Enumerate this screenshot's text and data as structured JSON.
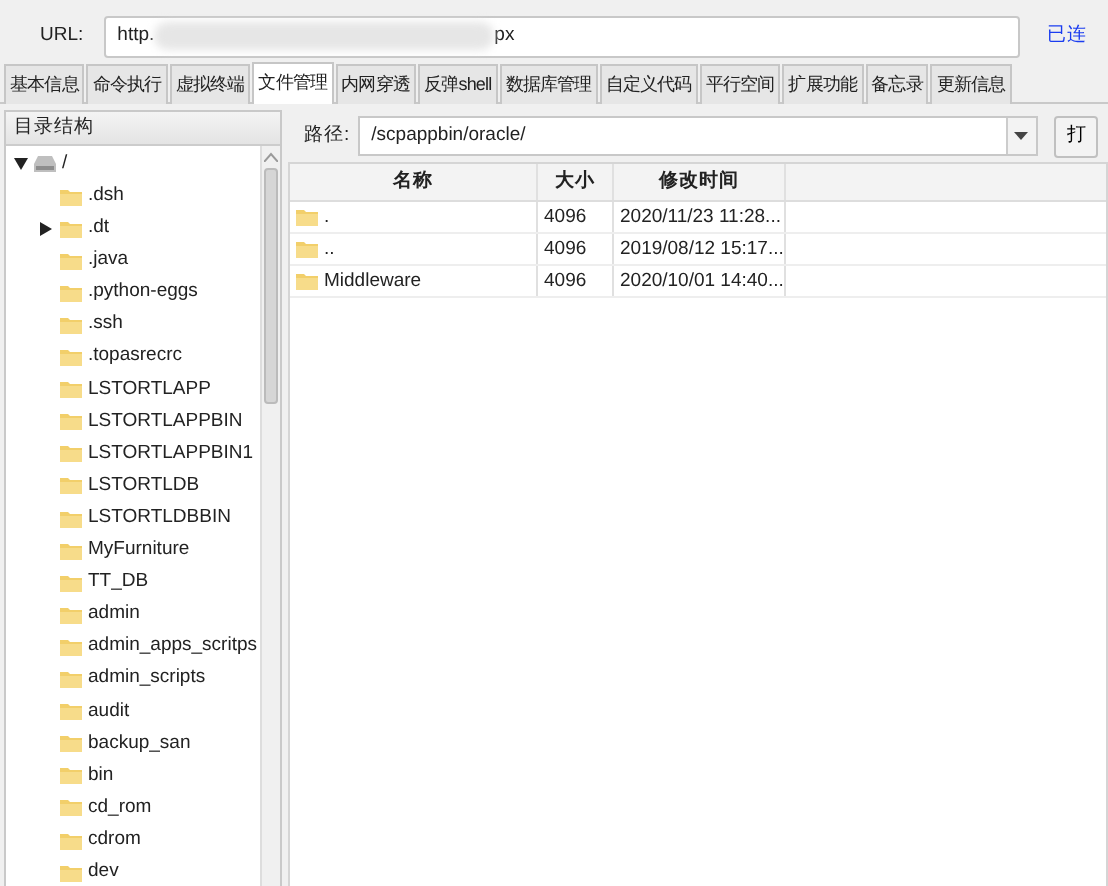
{
  "url_bar": {
    "label": "URL:",
    "value_start": "http.",
    "value_end": "px",
    "status": "已连"
  },
  "tabs": [
    {
      "label": "基本信息",
      "selected": false
    },
    {
      "label": "命令执行",
      "selected": false
    },
    {
      "label": "虚拟终端",
      "selected": false
    },
    {
      "label": "文件管理",
      "selected": true
    },
    {
      "label": "内网穿透",
      "selected": false
    },
    {
      "label": "反弹shell",
      "selected": false
    },
    {
      "label": "数据库管理",
      "selected": false
    },
    {
      "label": "自定义代码",
      "selected": false
    },
    {
      "label": "平行空间",
      "selected": false
    },
    {
      "label": "扩展功能",
      "selected": false
    },
    {
      "label": "备忘录",
      "selected": false
    },
    {
      "label": "更新信息",
      "selected": false
    }
  ],
  "tree": {
    "title": "目录结构",
    "items": [
      {
        "label": "/",
        "kind": "drive",
        "expanded": true,
        "children": [
          {
            "label": ".dsh",
            "kind": "folder"
          },
          {
            "label": ".dt",
            "kind": "folder",
            "expanded": false
          },
          {
            "label": ".java",
            "kind": "folder"
          },
          {
            "label": ".python-eggs",
            "kind": "folder"
          },
          {
            "label": ".ssh",
            "kind": "folder"
          },
          {
            "label": ".topasrecrc",
            "kind": "folder"
          },
          {
            "label": "LSTORTLAPP",
            "kind": "folder"
          },
          {
            "label": "LSTORTLAPPBIN",
            "kind": "folder"
          },
          {
            "label": "LSTORTLAPPBIN1",
            "kind": "folder"
          },
          {
            "label": "LSTORTLDB",
            "kind": "folder"
          },
          {
            "label": "LSTORTLDBBIN",
            "kind": "folder"
          },
          {
            "label": "MyFurniture",
            "kind": "folder"
          },
          {
            "label": "TT_DB",
            "kind": "folder"
          },
          {
            "label": "admin",
            "kind": "folder"
          },
          {
            "label": "admin_apps_scritps",
            "kind": "folder"
          },
          {
            "label": "admin_scripts",
            "kind": "folder"
          },
          {
            "label": "audit",
            "kind": "folder"
          },
          {
            "label": "backup_san",
            "kind": "folder"
          },
          {
            "label": "bin",
            "kind": "folder"
          },
          {
            "label": "cd_rom",
            "kind": "folder"
          },
          {
            "label": "cdrom",
            "kind": "folder"
          },
          {
            "label": "dev",
            "kind": "folder"
          }
        ]
      }
    ]
  },
  "path_bar": {
    "label": "路径:",
    "value": "/scpappbin/oracle/",
    "open_button": "打"
  },
  "table": {
    "columns": [
      "名称",
      "大小",
      "修改时间"
    ],
    "rows": [
      [
        ".",
        "4096",
        "2020/11/23 11:28..."
      ],
      [
        "..",
        "4096",
        "2019/08/12 15:17..."
      ],
      [
        "Middleware",
        "4096",
        "2020/10/01 14:40..."
      ]
    ]
  }
}
